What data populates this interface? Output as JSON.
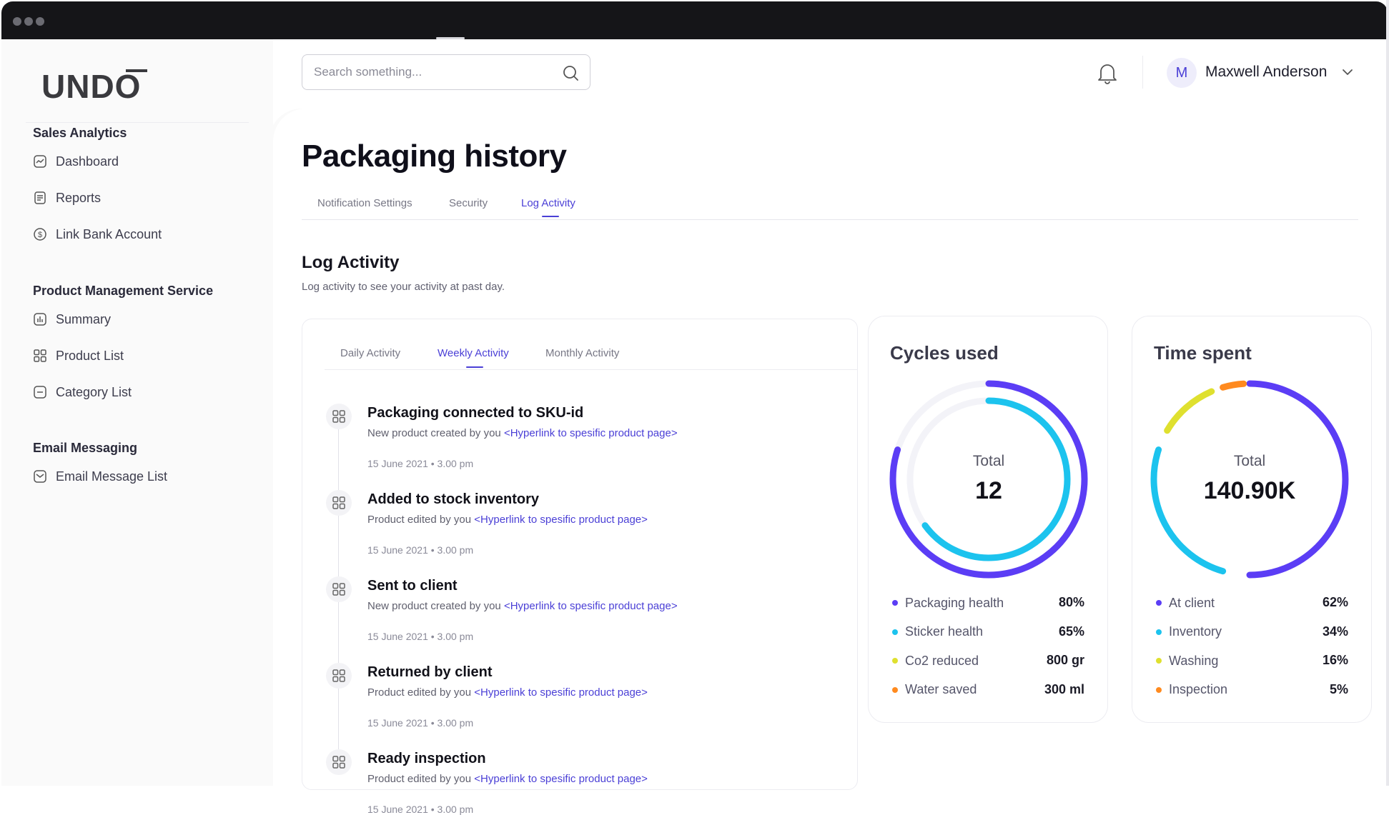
{
  "app": {
    "logo_text": "UNDO"
  },
  "search": {
    "placeholder": "Search something..."
  },
  "user": {
    "initial": "M",
    "name": "Maxwell Anderson"
  },
  "sidebar": {
    "sections": [
      {
        "title": "Sales Analytics",
        "items": [
          {
            "label": "Dashboard",
            "icon": "chart-icon"
          },
          {
            "label": "Reports",
            "icon": "document-icon"
          },
          {
            "label": "Link Bank Account",
            "icon": "dollar-icon"
          }
        ]
      },
      {
        "title": "Product Management Service",
        "items": [
          {
            "label": "Summary",
            "icon": "bar-chart-icon"
          },
          {
            "label": "Product List",
            "icon": "grid-icon"
          },
          {
            "label": "Category List",
            "icon": "folder-icon"
          }
        ]
      },
      {
        "title": "Email Messaging",
        "items": [
          {
            "label": "Email Message List",
            "icon": "mail-icon"
          }
        ]
      }
    ]
  },
  "page": {
    "title": "Packaging history",
    "tabs": [
      {
        "label": "Notification Settings",
        "active": false
      },
      {
        "label": "Security",
        "active": false
      },
      {
        "label": "Log Activity",
        "active": true
      }
    ],
    "section_title": "Log Activity",
    "section_subtitle": "Log activity to see your activity at past day."
  },
  "activity": {
    "subtabs": [
      {
        "label": "Daily Activity",
        "active": false
      },
      {
        "label": "Weekly Activity",
        "active": true
      },
      {
        "label": "Monthly Activity",
        "active": false
      }
    ],
    "items": [
      {
        "title": "Packaging connected to SKU-id",
        "desc": "New product created by you ",
        "link": "<Hyperlink to spesific product page>",
        "date": "15 June 2021",
        "time": "3.00 pm"
      },
      {
        "title": "Added to stock inventory",
        "desc": "Product edited by you ",
        "link": "<Hyperlink to spesific product page>",
        "date": "15 June 2021",
        "time": "3.00 pm"
      },
      {
        "title": "Sent to client",
        "desc": "New product created by you ",
        "link": "<Hyperlink to spesific product page>",
        "date": "15 June 2021",
        "time": "3.00 pm"
      },
      {
        "title": "Returned by client",
        "desc": "Product edited by you ",
        "link": "<Hyperlink to spesific product page>",
        "date": "15 June 2021",
        "time": "3.00 pm"
      },
      {
        "title": "Ready inspection",
        "desc": "Product edited by you ",
        "link": "<Hyperlink to spesific product page>",
        "date": "15 June 2021",
        "time": "3.00 pm"
      }
    ]
  },
  "colors": {
    "accent": "#4a3fd6",
    "purple": "#5b3df5",
    "cyan": "#1cc3ee",
    "yellow": "#dfe02f",
    "orange": "#ff8a1f"
  },
  "cycles": {
    "title": "Cycles used",
    "total_label": "Total",
    "total_value": "12",
    "legend": [
      {
        "label": "Packaging health",
        "value": "80%",
        "color": "#5b3df5"
      },
      {
        "label": "Sticker health",
        "value": "65%",
        "color": "#1cc3ee"
      },
      {
        "label": "Co2 reduced",
        "value": "800 gr",
        "color": "#dfe02f"
      },
      {
        "label": "Water saved",
        "value": "300 ml",
        "color": "#ff8a1f"
      }
    ],
    "rings": [
      {
        "name": "Packaging health",
        "fraction": 0.8,
        "color": "#5b3df5"
      },
      {
        "name": "Sticker health",
        "fraction": 0.65,
        "color": "#1cc3ee"
      }
    ]
  },
  "time_spent": {
    "title": "Time spent",
    "total_label": "Total",
    "total_value": "140.90K",
    "legend": [
      {
        "label": "At client",
        "value": "62%",
        "color": "#5b3df5"
      },
      {
        "label": "Inventory",
        "value": "34%",
        "color": "#1cc3ee"
      },
      {
        "label": "Washing",
        "value": "16%",
        "color": "#dfe02f"
      },
      {
        "label": "Inspection",
        "value": "5%",
        "color": "#ff8a1f"
      }
    ]
  }
}
